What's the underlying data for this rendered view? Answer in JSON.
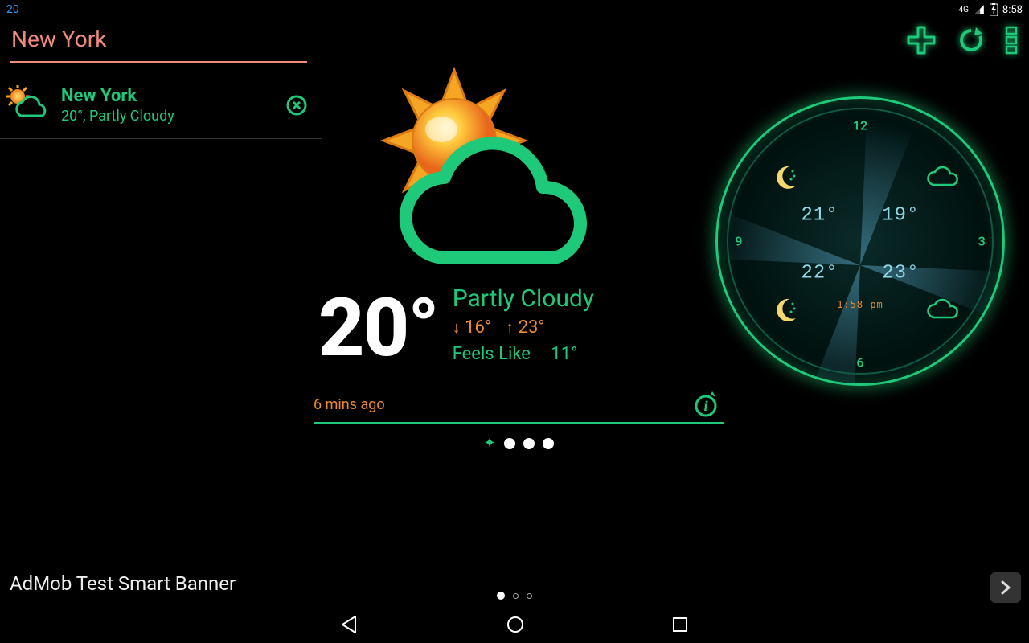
{
  "status": {
    "left": "20",
    "network": "4G",
    "time": "8:58"
  },
  "header": {
    "city": "New York"
  },
  "sidebar": {
    "items": [
      {
        "name": "New York",
        "summary": "20°, Partly Cloudy"
      }
    ]
  },
  "weather": {
    "temp": "20°",
    "condition": "Partly Cloudy",
    "low": "16°",
    "high": "23°",
    "feels_label": "Feels Like",
    "feels_value": "11°",
    "updated": "6 mins ago"
  },
  "clock": {
    "numbers": {
      "n12": "12",
      "n3": "3",
      "n6": "6",
      "n9": "9"
    },
    "t_nw": "21°",
    "t_ne": "19°",
    "t_sw": "22°",
    "t_se": "23°",
    "time": "1:58 pm"
  },
  "banner": {
    "text": "AdMob Test Smart Banner"
  }
}
